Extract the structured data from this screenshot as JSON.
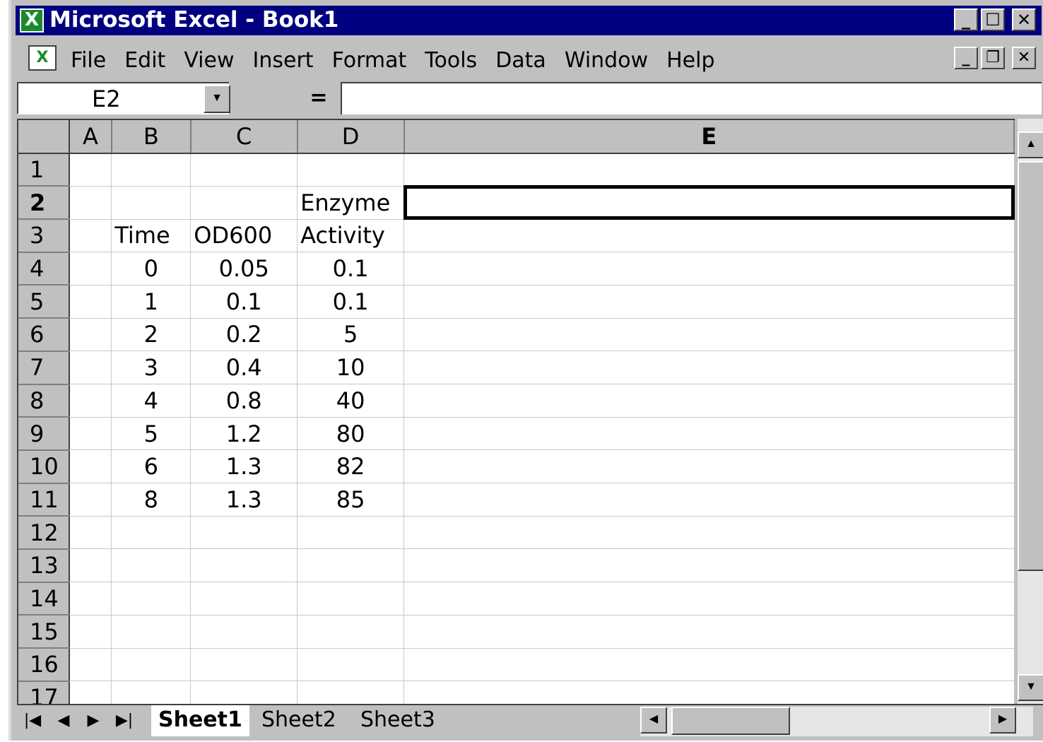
{
  "titlebar": {
    "title": "Microsoft Excel - Book1",
    "icon": "excel-icon",
    "minimize": "_",
    "maximize": "☐",
    "close": "✕"
  },
  "menubar": {
    "items": [
      "File",
      "Edit",
      "View",
      "Insert",
      "Format",
      "Tools",
      "Data",
      "Window",
      "Help"
    ],
    "doc_minimize": "_",
    "doc_restore": "❐",
    "doc_close": "✕"
  },
  "formulabar": {
    "name_box": "E2",
    "dropdown_glyph": "▼",
    "equals": "=",
    "formula": ""
  },
  "sheet": {
    "columns": [
      "A",
      "B",
      "C",
      "D",
      "E"
    ],
    "active_column": "E",
    "active_row": "2",
    "selected_cell": "E2",
    "rows": [
      {
        "n": "1",
        "A": "",
        "B": "",
        "C": "",
        "D": "",
        "E": ""
      },
      {
        "n": "2",
        "A": "",
        "B": "",
        "C": "",
        "D": "Enzyme",
        "E": ""
      },
      {
        "n": "3",
        "A": "",
        "B": "Time",
        "C": "OD600",
        "D": "Activity",
        "E": ""
      },
      {
        "n": "4",
        "A": "",
        "B": "0",
        "C": "0.05",
        "D": "0.1",
        "E": ""
      },
      {
        "n": "5",
        "A": "",
        "B": "1",
        "C": "0.1",
        "D": "0.1",
        "E": ""
      },
      {
        "n": "6",
        "A": "",
        "B": "2",
        "C": "0.2",
        "D": "5",
        "E": ""
      },
      {
        "n": "7",
        "A": "",
        "B": "3",
        "C": "0.4",
        "D": "10",
        "E": ""
      },
      {
        "n": "8",
        "A": "",
        "B": "4",
        "C": "0.8",
        "D": "40",
        "E": ""
      },
      {
        "n": "9",
        "A": "",
        "B": "5",
        "C": "1.2",
        "D": "80",
        "E": ""
      },
      {
        "n": "10",
        "A": "",
        "B": "6",
        "C": "1.3",
        "D": "82",
        "E": ""
      },
      {
        "n": "11",
        "A": "",
        "B": "8",
        "C": "1.3",
        "D": "85",
        "E": ""
      },
      {
        "n": "12",
        "A": "",
        "B": "",
        "C": "",
        "D": "",
        "E": ""
      },
      {
        "n": "13",
        "A": "",
        "B": "",
        "C": "",
        "D": "",
        "E": ""
      },
      {
        "n": "14",
        "A": "",
        "B": "",
        "C": "",
        "D": "",
        "E": ""
      },
      {
        "n": "15",
        "A": "",
        "B": "",
        "C": "",
        "D": "",
        "E": ""
      },
      {
        "n": "16",
        "A": "",
        "B": "",
        "C": "",
        "D": "",
        "E": ""
      },
      {
        "n": "17",
        "A": "",
        "B": "",
        "C": "",
        "D": "",
        "E": ""
      }
    ]
  },
  "scrollbars": {
    "up": "▲",
    "down": "▼",
    "left": "◀",
    "right": "▶"
  },
  "tabs": {
    "nav": [
      "|◀",
      "◀",
      "▶",
      "▶|"
    ],
    "sheets": [
      "Sheet1",
      "Sheet2",
      "Sheet3"
    ],
    "active": "Sheet1"
  }
}
